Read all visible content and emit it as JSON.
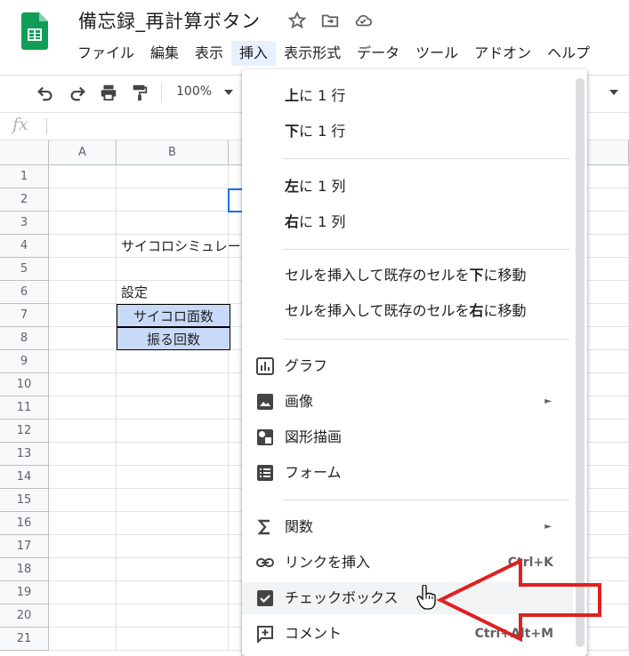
{
  "header": {
    "doc_title": "備忘録_再計算ボタン",
    "menu": [
      "ファイル",
      "編集",
      "表示",
      "挿入",
      "表示形式",
      "データ",
      "ツール",
      "アドオン",
      "ヘルプ"
    ]
  },
  "toolbar": {
    "zoom": "100%"
  },
  "formula_bar": {
    "fx": "fx"
  },
  "grid": {
    "columns": [
      "A",
      "B"
    ],
    "rows": [
      "1",
      "2",
      "3",
      "4",
      "5",
      "6",
      "7",
      "8",
      "9",
      "10",
      "11",
      "12",
      "13",
      "14",
      "15",
      "16",
      "17",
      "18",
      "19",
      "20",
      "21"
    ],
    "b4": "サイコロシミュレー",
    "b6": "設定",
    "b7": "サイコロ面数",
    "b8": "振る回数"
  },
  "insert_menu": {
    "row_above_bold": "上",
    "row_above_rest": "に 1 行",
    "row_below_bold": "下",
    "row_below_rest": "に 1 行",
    "col_left_bold": "左",
    "col_left_rest": "に 1 列",
    "col_right_bold": "右",
    "col_right_rest": "に 1 列",
    "shift_down_pre": "セルを挿入して既存のセルを",
    "shift_down_bold": "下",
    "shift_down_post": "に移動",
    "shift_right_pre": "セルを挿入して既存のセルを",
    "shift_right_bold": "右",
    "shift_right_post": "に移動",
    "chart": "グラフ",
    "image": "画像",
    "drawing": "図形描画",
    "form": "フォーム",
    "function": "関数",
    "link": "リンクを挿入",
    "link_shortcut": "Ctrl+K",
    "checkbox": "チェックボックス",
    "comment": "コメント",
    "comment_shortcut": "Ctrl+Alt+M",
    "submenu_arrow": "►"
  },
  "colors": {
    "accent": "#1a73e8",
    "annotation": "#e02020",
    "setting_fill": "#c9daf8"
  }
}
